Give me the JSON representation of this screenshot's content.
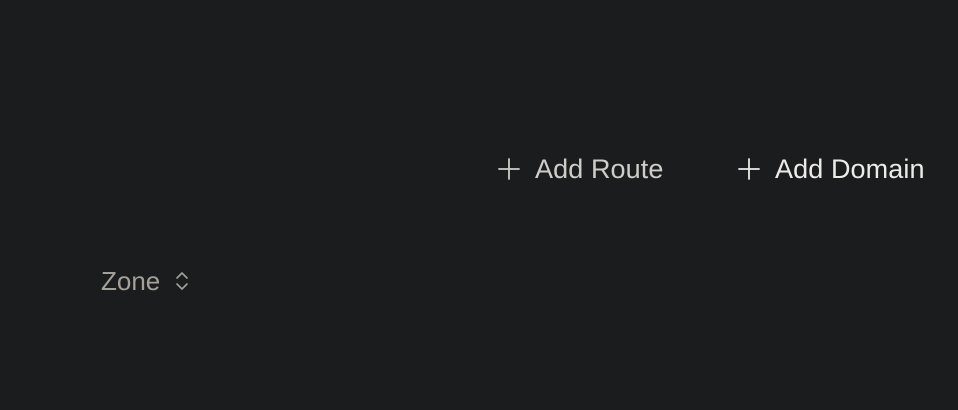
{
  "toolbar": {
    "add_route": {
      "label": "Add Route",
      "icon": "plus-icon"
    },
    "add_domain": {
      "label": "Add Domain",
      "icon": "plus-icon"
    }
  },
  "table": {
    "columns": [
      {
        "label": "Zone",
        "sort_icon": "sort-updown-icon"
      }
    ]
  },
  "colors": {
    "background": "#1b1c1e",
    "route_text": "#cfcdc8",
    "domain_text": "#ecebe7",
    "column_header_text": "#a3a09a"
  }
}
